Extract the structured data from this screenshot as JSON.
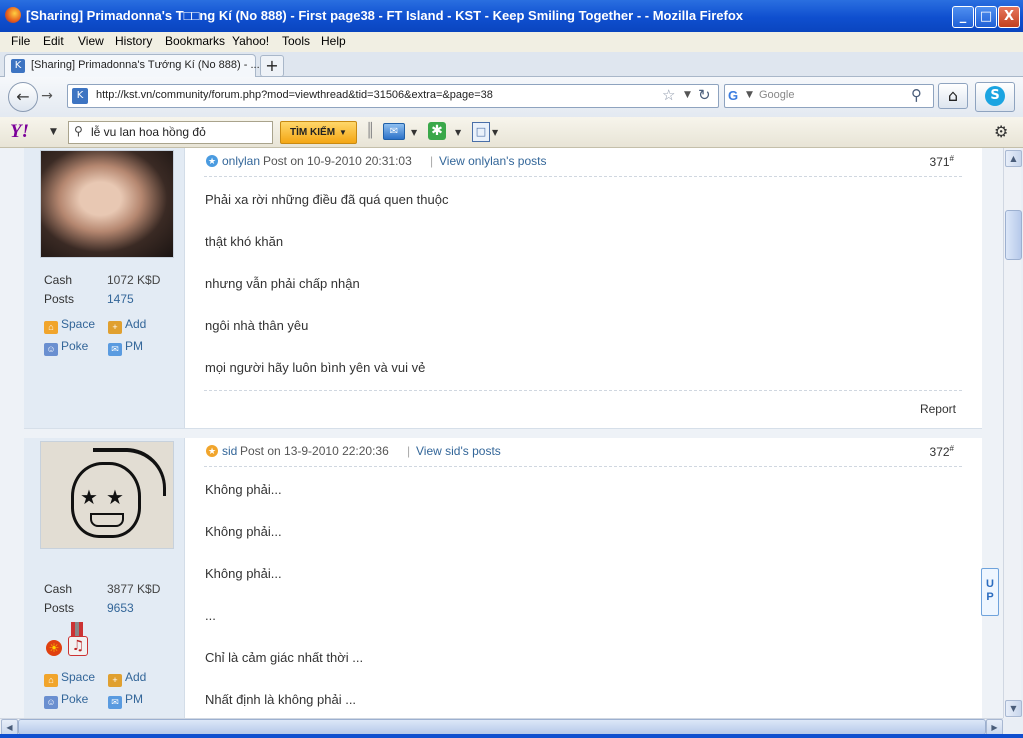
{
  "window": {
    "title": "[Sharing] Primadonna's T□□ng Kí (No 888) - First page38 - FT Island - KST - Keep Smiling Together - - Mozilla Firefox",
    "minimize": "_",
    "maximize": "□",
    "close": "X"
  },
  "menu": [
    "File",
    "Edit",
    "View",
    "History",
    "Bookmarks",
    "Yahoo!",
    "Tools",
    "Help"
  ],
  "tab": {
    "label": "[Sharing] Primadonna's Tướng Kí (No 888) - ...",
    "new_tab": "+"
  },
  "nav": {
    "url": "http://kst.vn/community/forum.php?mod=viewthread&tid=31506&extra=&page=38",
    "search_placeholder": "Google"
  },
  "yahoo": {
    "logo": "Y!",
    "search_value": "lễ vu lan hoa hồng đỏ",
    "search_button": "TÌM KIẾM"
  },
  "posts": [
    {
      "author": "onlylan",
      "posted": "Post on 10-9-2010 20:31:03",
      "view_posts": "View onlylan's posts",
      "number": "371",
      "cash_label": "Cash",
      "cash_value": "1072 K$D",
      "posts_label": "Posts",
      "posts_value": "1475",
      "space": "Space",
      "add": "Add",
      "poke": "Poke",
      "pm": "PM",
      "lines": [
        "Phải xa rời những điều đã quá quen thuộc",
        "thật khó khăn",
        "nhưng vẫn phải chấp nhận",
        "ngôi nhà thân yêu",
        "mọi người hãy luôn bình yên và vui vẻ"
      ],
      "report": "Report"
    },
    {
      "author": "sid",
      "posted": "Post on 13-9-2010 22:20:36",
      "view_posts": "View sid's posts",
      "number": "372",
      "cash_label": "Cash",
      "cash_value": "3877 K$D",
      "posts_label": "Posts",
      "posts_value": "9653",
      "space": "Space",
      "add": "Add",
      "poke": "Poke",
      "pm": "PM",
      "lines": [
        "Không phải...",
        "Không phải...",
        "Không phải...",
        "...",
        "Chỉ là cảm giác nhất thời ...",
        "Nhất định là không phải ..."
      ]
    }
  ],
  "up_button": "UP"
}
